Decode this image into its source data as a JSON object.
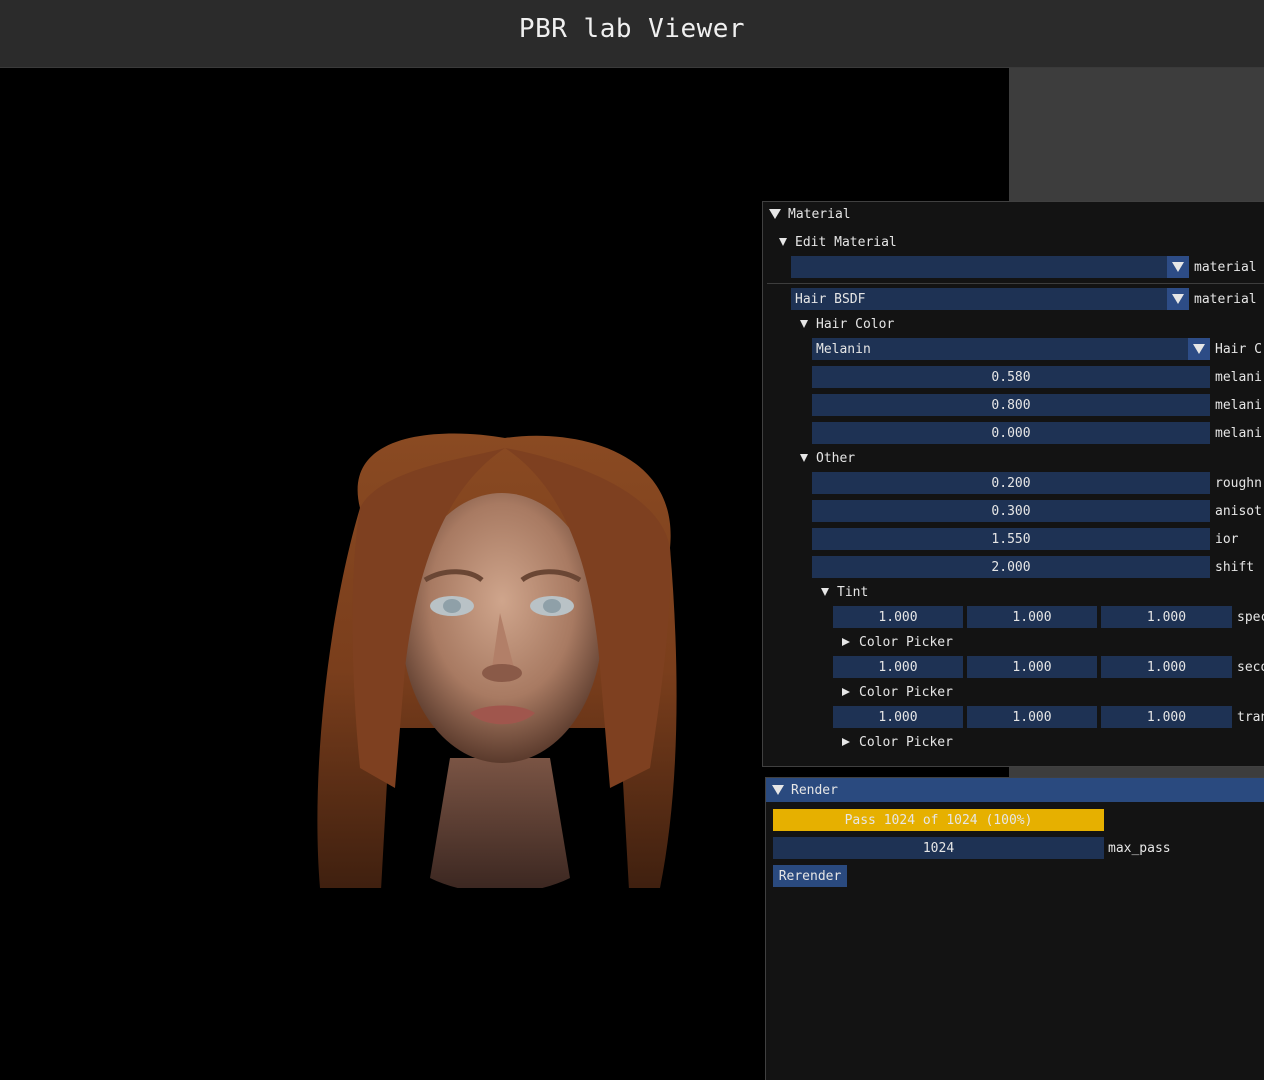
{
  "window": {
    "title": "PBR lab Viewer"
  },
  "material_panel": {
    "header": "Material",
    "edit_material": {
      "label": "Edit Material",
      "material_select": {
        "value": "",
        "side_label": "material"
      },
      "material_type": {
        "value": "Hair BSDF",
        "side_label": "material"
      }
    },
    "hair_color": {
      "label": "Hair Color",
      "mode": {
        "value": "Melanin",
        "side_label": "Hair C"
      },
      "params": [
        {
          "value": "0.580",
          "side_label": "melani"
        },
        {
          "value": "0.800",
          "side_label": "melani"
        },
        {
          "value": "0.000",
          "side_label": "melani"
        }
      ]
    },
    "other": {
      "label": "Other",
      "params": [
        {
          "value": "0.200",
          "side_label": "roughn"
        },
        {
          "value": "0.300",
          "side_label": "anisot"
        },
        {
          "value": "1.550",
          "side_label": "ior"
        },
        {
          "value": "2.000",
          "side_label": "shift"
        }
      ]
    },
    "tint": {
      "label": "Tint",
      "rows": [
        {
          "values": [
            "1.000",
            "1.000",
            "1.000"
          ],
          "side_label": "spec",
          "picker_label": "Color Picker"
        },
        {
          "values": [
            "1.000",
            "1.000",
            "1.000"
          ],
          "side_label": "seco",
          "picker_label": "Color Picker"
        },
        {
          "values": [
            "1.000",
            "1.000",
            "1.000"
          ],
          "side_label": "tran",
          "picker_label": "Color Picker"
        }
      ]
    }
  },
  "render_panel": {
    "header": "Render",
    "progress": {
      "text": "Pass 1024 of 1024 (100%)",
      "fraction": 1.0,
      "color": "#e6b000"
    },
    "max_pass": {
      "value": "1024",
      "side_label": "max_pass"
    },
    "rerender_label": "Rerender"
  },
  "colors": {
    "field_bg": "#1e3254",
    "header_bg": "#2a4a7f",
    "accent": "#2d4c86"
  }
}
